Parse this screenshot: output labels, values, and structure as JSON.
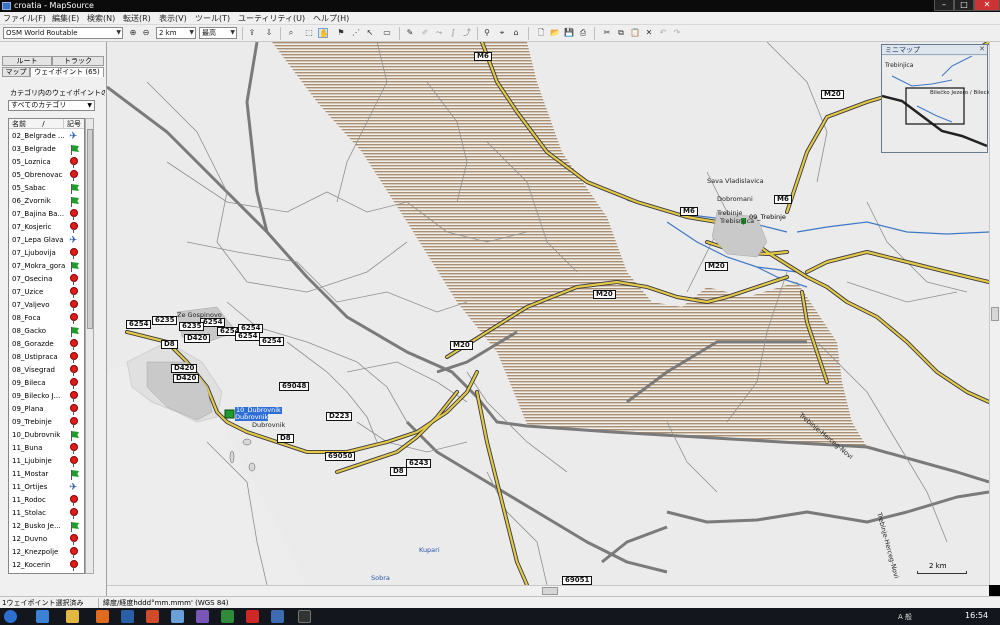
{
  "window": {
    "title": "croatia - MapSource",
    "buttons": {
      "minimize": "–",
      "maximize": "□",
      "close": "✕"
    }
  },
  "menu": [
    "ファイル(F)",
    "編集(E)",
    "検索(N)",
    "転送(R)",
    "表示(V)",
    "ツール(T)",
    "ユーティリティ(U)",
    "ヘルプ(H)"
  ],
  "toolbar": {
    "map_product": "OSM World Routable",
    "zoom_scale": "2 km",
    "detail_level": "最高"
  },
  "panel": {
    "tabs": {
      "route": "ルート",
      "track": "トラック",
      "map": "マップ",
      "waypoints": "ウェイポイント (65)"
    },
    "category_label": "カテゴリ内のウェイポイントの表",
    "category_select": "すべてのカテゴリ",
    "columns": {
      "name": "名前",
      "sort": "/",
      "symbol": "記号"
    },
    "waypoints": [
      {
        "name": "02_Belgrade ...",
        "symbol": "plane"
      },
      {
        "name": "03_Belgrade",
        "symbol": "flag"
      },
      {
        "name": "05_Loznica",
        "symbol": "pin"
      },
      {
        "name": "05_Obrenovac",
        "symbol": "pin"
      },
      {
        "name": "05_Sabac",
        "symbol": "flag"
      },
      {
        "name": "06_Zvornik",
        "symbol": "flag"
      },
      {
        "name": "07_Bajina Ba...",
        "symbol": "pin"
      },
      {
        "name": "07_Kosjeric",
        "symbol": "pin"
      },
      {
        "name": "07_Lepa Glava",
        "symbol": "plane"
      },
      {
        "name": "07_Ljubovija",
        "symbol": "pin"
      },
      {
        "name": "07_Mokra_gora",
        "symbol": "flag"
      },
      {
        "name": "07_Osecina",
        "symbol": "pin"
      },
      {
        "name": "07_Uzice",
        "symbol": "pin"
      },
      {
        "name": "07_Valjevo",
        "symbol": "pin"
      },
      {
        "name": "08_Foca",
        "symbol": "pin"
      },
      {
        "name": "08_Gacko",
        "symbol": "flag"
      },
      {
        "name": "08_Gorazde",
        "symbol": "pin"
      },
      {
        "name": "08_Ustipraca",
        "symbol": "pin"
      },
      {
        "name": "08_Visegrad",
        "symbol": "pin"
      },
      {
        "name": "09_Bileca",
        "symbol": "pin"
      },
      {
        "name": "09_Bilecko J...",
        "symbol": "pin"
      },
      {
        "name": "09_Plana",
        "symbol": "pin"
      },
      {
        "name": "09_Trebinje",
        "symbol": "pin"
      },
      {
        "name": "10_Dubrovnik",
        "symbol": "flag"
      },
      {
        "name": "11_Buna",
        "symbol": "pin"
      },
      {
        "name": "11_Ljubinje",
        "symbol": "pin"
      },
      {
        "name": "11_Mostar",
        "symbol": "flag"
      },
      {
        "name": "11_Ortijes",
        "symbol": "plane"
      },
      {
        "name": "11_Rodoc",
        "symbol": "pin"
      },
      {
        "name": "11_Stolac",
        "symbol": "pin"
      },
      {
        "name": "12_Busko Je...",
        "symbol": "flag"
      },
      {
        "name": "12_Duvno",
        "symbol": "pin"
      },
      {
        "name": "12_Knezpolje",
        "symbol": "pin"
      },
      {
        "name": "12_Kocerin",
        "symbol": "pin"
      }
    ]
  },
  "map": {
    "roads": [
      "M6",
      "M6",
      "M6",
      "M20",
      "M20",
      "M20",
      "M20",
      "D420",
      "D420",
      "D420",
      "D8",
      "D8",
      "D8",
      "D223",
      "6254",
      "6254",
      "6254",
      "6254",
      "6254",
      "6254",
      "6235",
      "6235",
      "6243",
      "69048",
      "69050",
      "69051"
    ],
    "places": [
      "Ze Gospinovo",
      "Sava Vladislavica",
      "Dobromani",
      "Trebinje",
      "Trebisnjica"
    ],
    "waypoint_labels": [
      "10_Dubrovnik",
      "Dubrovnik",
      "09_Trebinje",
      "Dubrovnik"
    ],
    "road_names": [
      "Trebinje-Herceg-Novi",
      "Trebinje-Herceg-Novi"
    ],
    "poi": [
      "Kupari",
      "Sobra"
    ],
    "scale": "2 km"
  },
  "minimap": {
    "title": "ミニマップ",
    "labels": [
      "Trebinjica",
      "Bilečko Jezero / Bilecko"
    ]
  },
  "status": {
    "selection": "1ウェイポイント選択済み",
    "coord_format": "緯度/経度hddd°mm.mmm' (WGS 84)"
  },
  "taskbar": {
    "language": "A 般",
    "clock": "16:54"
  },
  "colors": {
    "road_major": "#e3c84a",
    "road_casing": "#3a3a3a",
    "border": "#7a7a7a",
    "water": "#3f77c6",
    "hatch": "#a88e74"
  }
}
